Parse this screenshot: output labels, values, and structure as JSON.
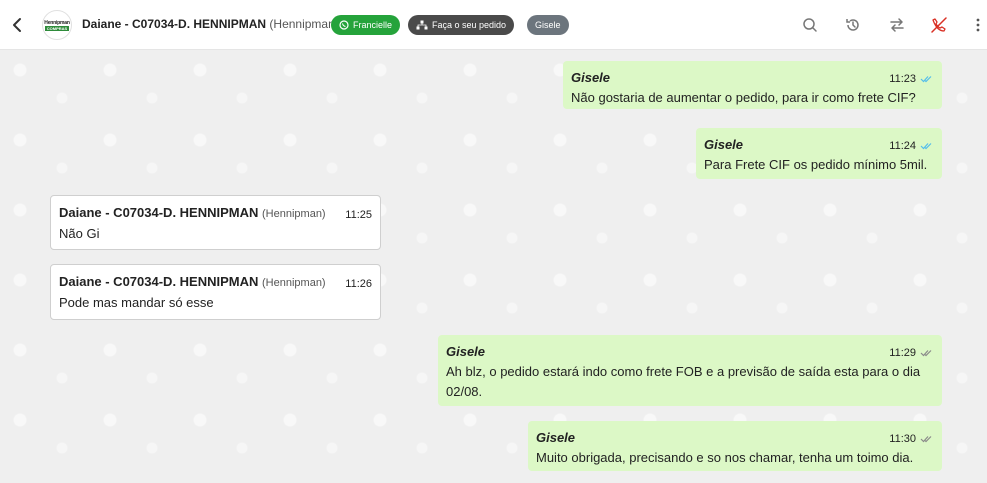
{
  "header": {
    "avatar_line1": "Hennipman",
    "avatar_line2": "COMPRAS",
    "contact_name": "Daiane - C07034-D. HENNIPMAN",
    "contact_sub": "(Hennipman)",
    "tags": {
      "whatsapp": "Francielle",
      "order": "Faça o seu pedido",
      "agent": "Gisele"
    },
    "icons": [
      "search-icon",
      "history-icon",
      "transfer-icon",
      "end-call-icon",
      "more-vertical-icon"
    ]
  },
  "colors": {
    "outgoing_bubble": "#dcf8c6",
    "incoming_bubble": "#ffffff",
    "tag_green": "#25a33b",
    "tag_dark": "#4a4a4a",
    "tag_grey": "#6c757d",
    "end_call_red": "#d93025",
    "read_ticks_blue": "#53bdeb"
  },
  "messages": [
    {
      "direction": "out",
      "sender": "Gisele",
      "time": "11:23",
      "status": "read",
      "text": "Não gostaria de aumentar o pedido, para ir como frete CIF?"
    },
    {
      "direction": "out",
      "sender": "Gisele",
      "time": "11:24",
      "status": "read",
      "text": "Para Frete CIF os pedido mínimo 5mil."
    },
    {
      "direction": "in",
      "sender": "Daiane - C07034-D. HENNIPMAN",
      "sender_sub": "(Hennipman)",
      "time": "11:25",
      "text": "Não Gi"
    },
    {
      "direction": "in",
      "sender": "Daiane - C07034-D. HENNIPMAN",
      "sender_sub": "(Hennipman)",
      "time": "11:26",
      "text": "Pode mas mandar só esse"
    },
    {
      "direction": "out",
      "sender": "Gisele",
      "time": "11:29",
      "status": "delivered",
      "text": "Ah blz, o pedido estará indo como frete FOB e a previsão de saída esta para o dia 02/08."
    },
    {
      "direction": "out",
      "sender": "Gisele",
      "time": "11:30",
      "status": "delivered",
      "text": "Muito obrigada, precisando e so nos chamar, tenha um toimo dia."
    }
  ]
}
